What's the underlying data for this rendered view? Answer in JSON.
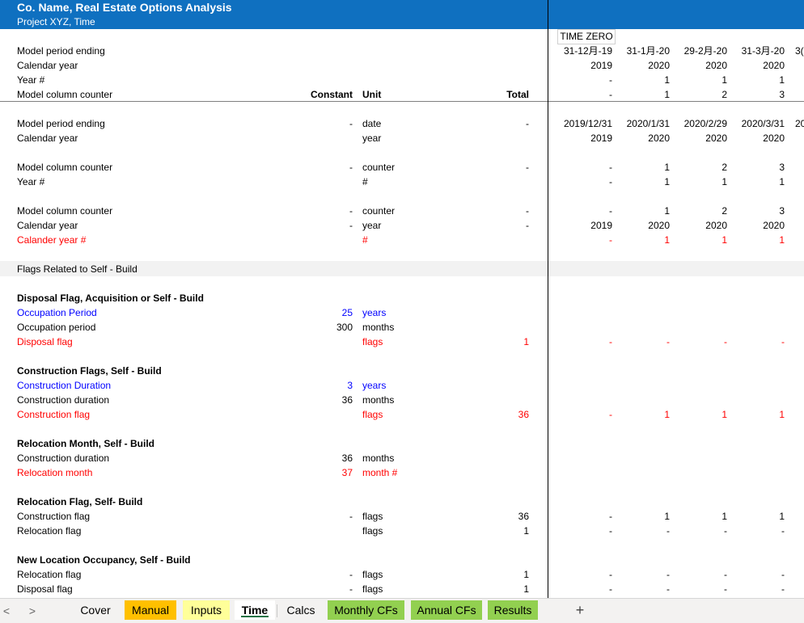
{
  "header": {
    "title": "Co. Name, Real Estate Options Analysis",
    "subtitle": "Project XYZ, Time"
  },
  "time_zero": "TIME ZERO",
  "top": {
    "model_period_ending": {
      "label": "Model period ending",
      "vals": [
        "31-12月-19",
        "31-1月-20",
        "29-2月-20",
        "31-3月-20",
        "3("
      ]
    },
    "calendar_year": {
      "label": "Calendar year",
      "vals": [
        "2019",
        "2020",
        "2020",
        "2020"
      ]
    },
    "year_num": {
      "label": "Year #",
      "vals": [
        "-",
        "1",
        "1",
        "1"
      ]
    },
    "column_counter": {
      "label": "Model column counter",
      "vals": [
        "-",
        "1",
        "2",
        "3"
      ]
    }
  },
  "headers": {
    "constant": "Constant",
    "unit": "Unit",
    "total": "Total"
  },
  "rows": {
    "r1": {
      "label": "Model period ending",
      "constant": "-",
      "unit": "date",
      "total": "-",
      "vals": [
        "2019/12/31",
        "2020/1/31",
        "2020/2/29",
        "2020/3/31",
        "20"
      ]
    },
    "r2": {
      "label": "Calendar year",
      "constant": "",
      "unit": "year",
      "total": "",
      "vals": [
        "2019",
        "2020",
        "2020",
        "2020"
      ]
    },
    "r3": {
      "label": "Model column counter",
      "constant": "-",
      "unit": "counter",
      "total": "-",
      "vals": [
        "-",
        "1",
        "2",
        "3"
      ]
    },
    "r4": {
      "label": "Year #",
      "constant": "",
      "unit": "#",
      "total": "",
      "vals": [
        "-",
        "1",
        "1",
        "1"
      ]
    },
    "r5": {
      "label": "Model column counter",
      "constant": "-",
      "unit": "counter",
      "total": "-",
      "vals": [
        "-",
        "1",
        "2",
        "3"
      ]
    },
    "r6": {
      "label": "Calendar year",
      "constant": "-",
      "unit": "year",
      "total": "-",
      "vals": [
        "2019",
        "2020",
        "2020",
        "2020"
      ]
    },
    "r7": {
      "label": "Calander year #",
      "constant": "",
      "unit": "#",
      "total": "",
      "vals": [
        "-",
        "1",
        "1",
        "1"
      ]
    }
  },
  "section": "Flags Related to Self - Build",
  "disposal": {
    "title": "Disposal Flag, Acquisition or Self - Build",
    "occ_input": {
      "label": "Occupation Period",
      "constant": "25",
      "unit": "years"
    },
    "occ_period": {
      "label": "Occupation period",
      "constant": "300",
      "unit": "months"
    },
    "flag": {
      "label": "Disposal flag",
      "unit": "flags",
      "total": "1",
      "vals": [
        "-",
        "-",
        "-",
        "-"
      ]
    }
  },
  "construction": {
    "title": "Construction Flags, Self - Build",
    "dur_input": {
      "label": "Construction Duration",
      "constant": "3",
      "unit": "years"
    },
    "duration": {
      "label": "Construction duration",
      "constant": "36",
      "unit": "months"
    },
    "flag": {
      "label": "Construction flag",
      "unit": "flags",
      "total": "36",
      "vals": [
        "-",
        "1",
        "1",
        "1"
      ]
    }
  },
  "relocation_month": {
    "title": "Relocation Month, Self - Build",
    "duration": {
      "label": "Construction duration",
      "constant": "36",
      "unit": "months"
    },
    "month": {
      "label": "Relocation month",
      "constant": "37",
      "unit": "month #"
    }
  },
  "relocation_flag": {
    "title": "Relocation Flag, Self- Build",
    "construction": {
      "label": "Construction flag",
      "constant": "-",
      "unit": "flags",
      "total": "36",
      "vals": [
        "-",
        "1",
        "1",
        "1"
      ]
    },
    "relocation": {
      "label": "Relocation flag",
      "constant": "",
      "unit": "flags",
      "total": "1",
      "vals": [
        "-",
        "-",
        "-",
        "-"
      ]
    }
  },
  "new_location": {
    "title": "New Location Occupancy, Self - Build",
    "relocation": {
      "label": "Relocation flag",
      "constant": "-",
      "unit": "flags",
      "total": "1",
      "vals": [
        "-",
        "-",
        "-",
        "-"
      ]
    },
    "disposal": {
      "label": "Disposal flag",
      "constant": "-",
      "unit": "flags",
      "total": "1",
      "vals": [
        "-",
        "-",
        "-",
        "-"
      ]
    }
  },
  "tabs": {
    "prev": "<",
    "next": ">",
    "cover": "Cover",
    "manual": "Manual",
    "inputs": "Inputs",
    "time": "Time",
    "calcs": "Calcs",
    "monthly": "Monthly CFs",
    "annual": "Annual CFs",
    "results": "Results",
    "add": "+"
  },
  "colors": {
    "header_bg": "#0f70c0",
    "red": "#ff0000",
    "blue": "#0000ff",
    "tab_manual": "#ffc000",
    "tab_inputs": "#ffff99",
    "tab_green": "#92d050"
  }
}
